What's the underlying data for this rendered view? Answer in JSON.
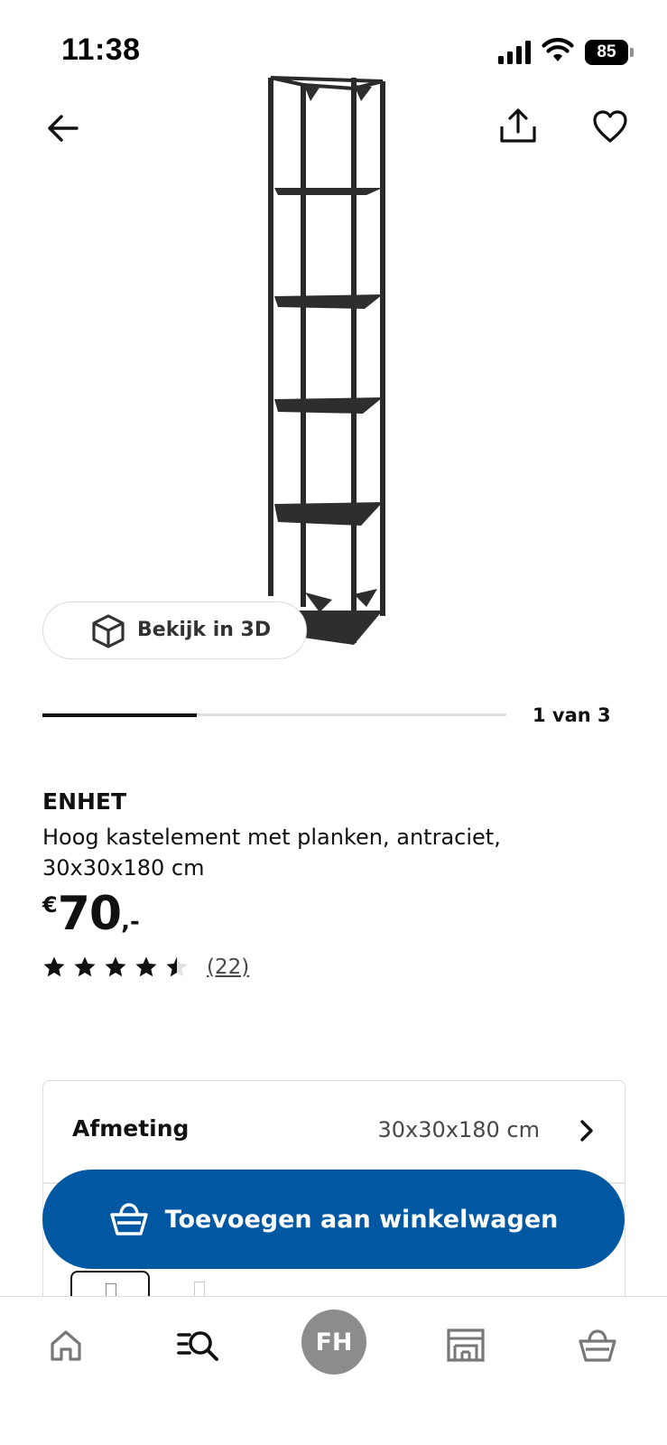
{
  "status_bar": {
    "time": "11:38",
    "battery": "85",
    "icons": [
      "signal-icon",
      "wifi-icon",
      "battery-icon"
    ]
  },
  "top_nav": {
    "back_icon": "arrow-left-icon",
    "share_icon": "share-icon",
    "favorite_icon": "heart-icon"
  },
  "gallery": {
    "view_3d_label": "Bekijk in 3D",
    "view_3d_icon": "cube-icon",
    "position_label": "1 van 3",
    "current_index": 1,
    "total_images": 3
  },
  "product": {
    "name": "ENHET",
    "description": "Hoog kastelement met planken, antraciet, 30x30x180 cm",
    "price": {
      "currency": "€",
      "amount": "70",
      "decimals": ",-"
    },
    "rating": {
      "value": 4.5,
      "max": 5,
      "reviews_label": "(22)"
    }
  },
  "size_selector": {
    "label": "Afmeting",
    "value": "30x30x180 cm",
    "chevron_icon": "chevron-right-icon"
  },
  "cta": {
    "label": "Toevoegen aan winkelwagen",
    "icon": "shopping-basket-icon",
    "color": "#0058a3"
  },
  "tab_bar": {
    "items": [
      {
        "id": "home",
        "icon": "home-icon"
      },
      {
        "id": "search",
        "icon": "search-list-icon"
      },
      {
        "id": "profile",
        "label": "FH"
      },
      {
        "id": "store",
        "icon": "store-icon"
      },
      {
        "id": "cart",
        "icon": "shopping-basket-icon"
      }
    ]
  }
}
